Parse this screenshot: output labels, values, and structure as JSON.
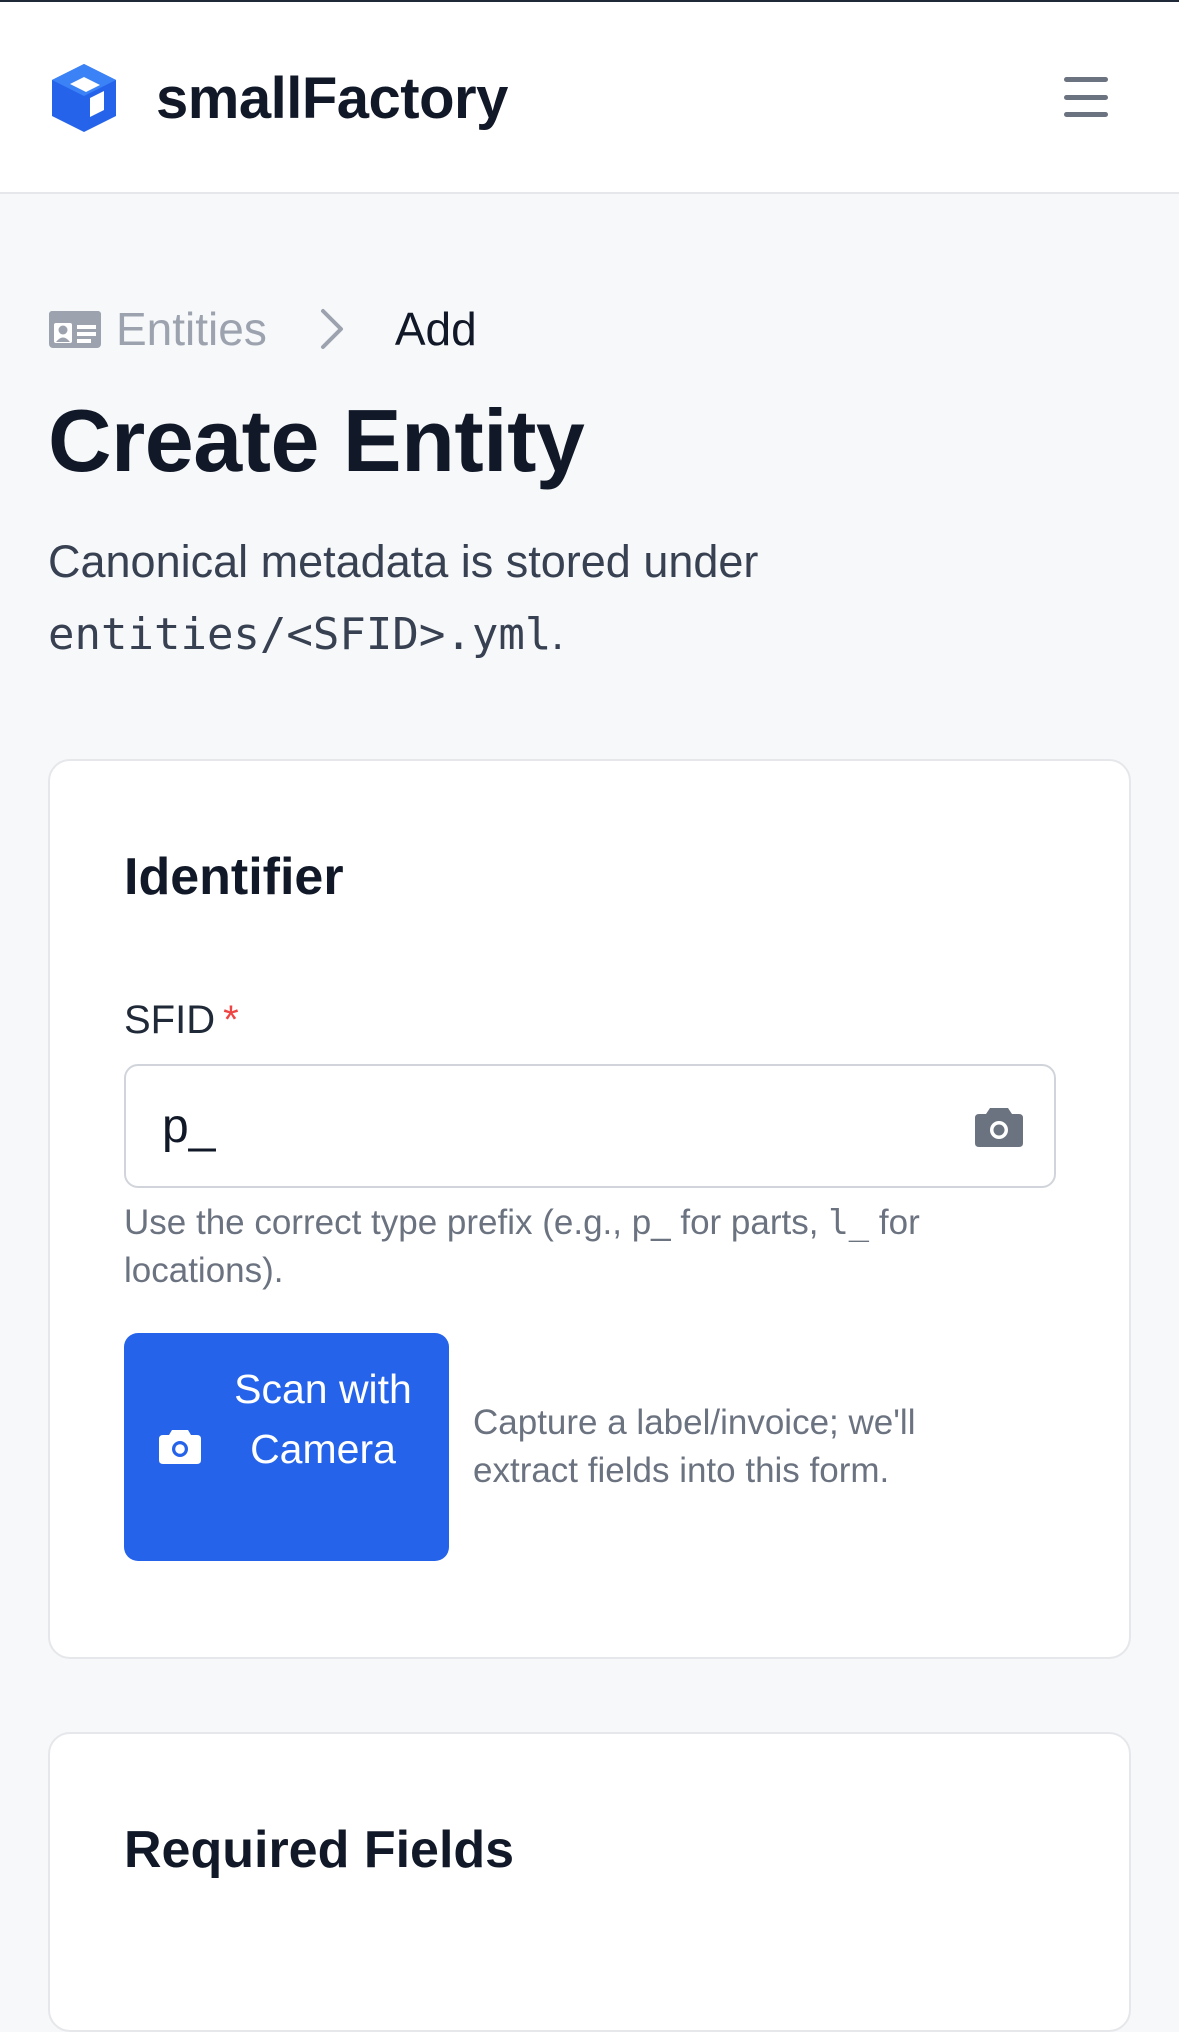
{
  "header": {
    "brand": "smallFactory",
    "menu_icon": "hamburger-icon",
    "logo_icon": "cube-icon",
    "accent_color": "#2563eb"
  },
  "breadcrumb": {
    "icon": "id-card-icon",
    "parent": "Entities",
    "current": "Add"
  },
  "page": {
    "title": "Create Entity",
    "description_prefix": "Canonical metadata is stored under",
    "description_code": "entities/<SFID>.yml",
    "description_suffix": "."
  },
  "identifier_card": {
    "title": "Identifier",
    "sfid_label": "SFID",
    "required_marker": "*",
    "sfid_value": "p_",
    "help_before": "Use the correct type prefix (e.g., p_ for parts,",
    "help_code": "l_",
    "help_after": "for locations).",
    "scan_button_label": "Scan with Camera",
    "scan_hint": "Capture a label/invoice; we'll extract fields into this form."
  },
  "required_card": {
    "title": "Required Fields"
  }
}
